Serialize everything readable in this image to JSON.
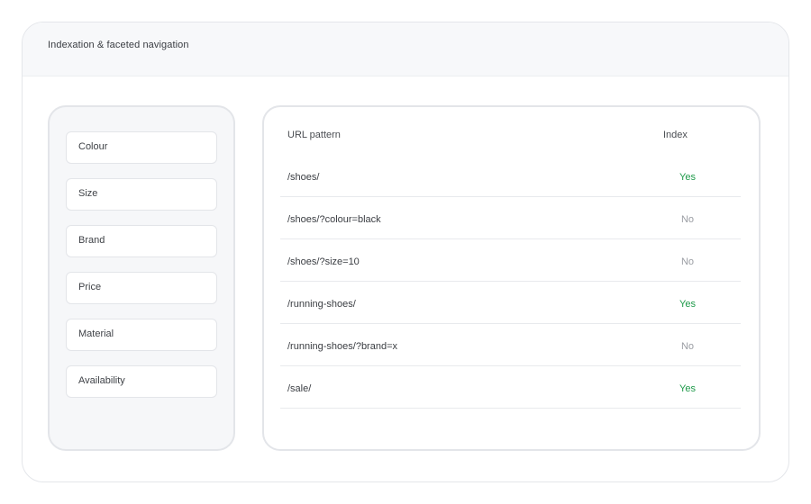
{
  "header": {
    "title": "Indexation & faceted navigation"
  },
  "facets": [
    {
      "label": "Colour"
    },
    {
      "label": "Size"
    },
    {
      "label": "Brand"
    },
    {
      "label": "Price"
    },
    {
      "label": "Material"
    },
    {
      "label": "Availability"
    }
  ],
  "table": {
    "columns": {
      "url": "URL pattern",
      "index": "Index"
    },
    "rows": [
      {
        "url": "/shoes/",
        "index": "Yes"
      },
      {
        "url": "/shoes/?colour=black",
        "index": "No"
      },
      {
        "url": "/shoes/?size=10",
        "index": "No"
      },
      {
        "url": "/running-shoes/",
        "index": "Yes"
      },
      {
        "url": "/running-shoes/?brand=x",
        "index": "No"
      },
      {
        "url": "/sale/",
        "index": "Yes"
      }
    ]
  },
  "colors": {
    "yes": "#1f9a4a",
    "no": "#9a9da3",
    "panel_bg": "#f6f7f9",
    "border": "#e3e5e9"
  }
}
